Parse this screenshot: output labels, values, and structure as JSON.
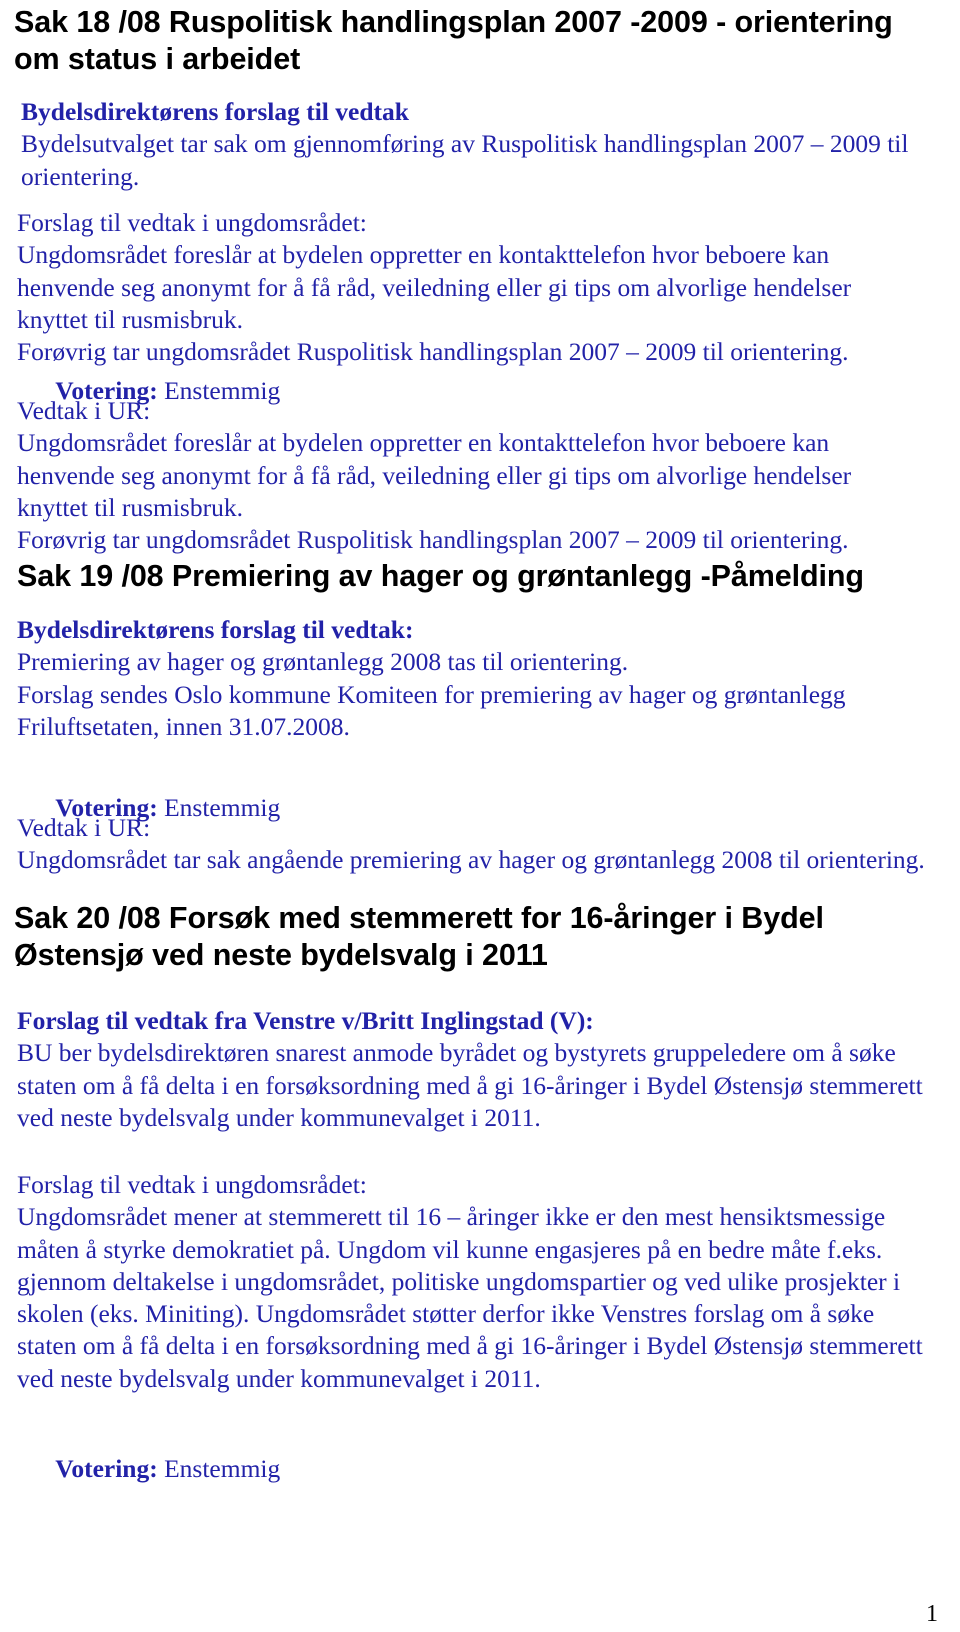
{
  "document": {
    "page_number": "1",
    "text_color_blue": "#2222a8",
    "text_color_black": "#000000"
  },
  "sections": [
    {
      "id": "sak-18",
      "heading": "Sak 18 /08  Ruspolitisk handlingsplan 2007 -2009 - orientering om status i arbeidet",
      "blocks": [
        {
          "id": "sak18-bd-forslag",
          "lead": "Bydelsdirektørens forslag til vedtak",
          "body": "Bydelsutvalget tar sak om gjennomføring av Ruspolitisk handlingsplan 2007 – 2009 til orientering."
        },
        {
          "id": "sak18-ur-forslag",
          "lead": "Forslag til vedtak i ungdomsrådet:",
          "body": "Ungdomsrådet foreslår at bydelen oppretter en kontakttelefon hvor beboere kan henvende seg anonymt for å få råd, veiledning eller gi tips om alvorlige hendelser knyttet til rusmisbruk.\nForøvrig tar ungdomsrådet Ruspolitisk handlingsplan 2007 – 2009 til orientering."
        },
        {
          "id": "sak18-votering",
          "votering_label": "Votering:",
          "votering_value": " Enstemmig"
        },
        {
          "id": "sak18-vedtak",
          "lead": "Vedtak i UR:",
          "body": "Ungdomsrådet foreslår at bydelen oppretter en kontakttelefon hvor beboere kan henvende seg anonymt for å få råd, veiledning eller gi tips om alvorlige hendelser knyttet til rusmisbruk.\nForøvrig tar ungdomsrådet Ruspolitisk handlingsplan 2007 – 2009 til orientering."
        }
      ]
    },
    {
      "id": "sak-19",
      "heading": "Sak 19 /08  Premiering av hager og grøntanlegg -Påmelding",
      "blocks": [
        {
          "id": "sak19-bd-forslag",
          "lead": "Bydelsdirektørens forslag til vedtak:",
          "body": "Premiering av hager og grøntanlegg 2008 tas til orientering.\nForslag sendes Oslo kommune Komiteen for premiering av hager og grøntanlegg Friluftsetaten, innen 31.07.2008."
        },
        {
          "id": "sak19-votering",
          "votering_label": "Votering:",
          "votering_value": " Enstemmig"
        },
        {
          "id": "sak19-vedtak",
          "lead": "Vedtak i UR:",
          "body": "Ungdomsrådet tar sak angående premiering av hager og grøntanlegg 2008 til orientering."
        }
      ]
    },
    {
      "id": "sak-20",
      "heading": "Sak 20 /08  Forsøk med stemmerett for 16-åringer i Bydel Østensjø ved neste bydelsvalg i 2011",
      "blocks": [
        {
          "id": "sak20-venstre-forslag",
          "lead": "Forslag til vedtak fra Venstre v/Britt Inglingstad (V):",
          "body": "BU ber bydelsdirektøren snarest anmode byrådet og bystyrets gruppeledere om å søke staten om å få delta i en forsøksordning med å gi 16-åringer i Bydel Østensjø stemmerett ved neste bydelsvalg under kommunevalget i 2011."
        },
        {
          "id": "sak20-ur-forslag",
          "lead": "Forslag til vedtak i ungdomsrådet:",
          "body": "Ungdomsrådet mener at stemmerett til 16 – åringer ikke er den mest hensiktsmessige måten å styrke demokratiet på. Ungdom vil kunne engasjeres på en bedre måte f.eks. gjennom deltakelse i ungdomsrådet, politiske ungdomspartier og ved ulike prosjekter i skolen (eks. Miniting). Ungdomsrådet støtter derfor ikke Venstres forslag om å søke staten om å få delta i en forsøksordning med å gi 16-åringer i Bydel Østensjø stemmerett ved neste bydelsvalg under kommunevalget i 2011."
        },
        {
          "id": "sak20-votering",
          "votering_label": "Votering:",
          "votering_value": " Enstemmig"
        }
      ]
    }
  ]
}
